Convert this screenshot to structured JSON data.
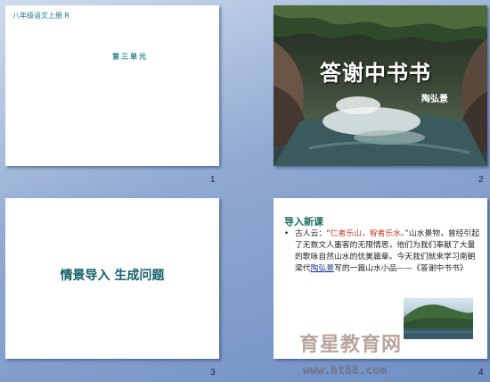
{
  "slides": [
    {
      "number": "1",
      "header": "八年级语文上册 R",
      "unit": "第三单元"
    },
    {
      "number": "2",
      "title": "答谢中书书",
      "author": "陶弘景",
      "image": "river-gorge-photo"
    },
    {
      "number": "3",
      "title": "情景导入 生成问题"
    },
    {
      "number": "4",
      "heading": "导入新课",
      "bullet": "•",
      "text_pre": "古人云：“",
      "quote": "仁者乐山，智者乐水。",
      "text_mid": "”山水景物，曾经引起了无数文人墨客的无限情思，他们为我们奉献了大量的歌咏自然山水的优美篇章。今天我们就来学习南朝梁代",
      "author_link": "陶弘景",
      "text_post": "写的一篇山水小品——《答谢中书书》",
      "image": "mountain-lake-photo"
    }
  ],
  "watermark": {
    "name": "育星教育网",
    "url": "www.ht88.com"
  }
}
